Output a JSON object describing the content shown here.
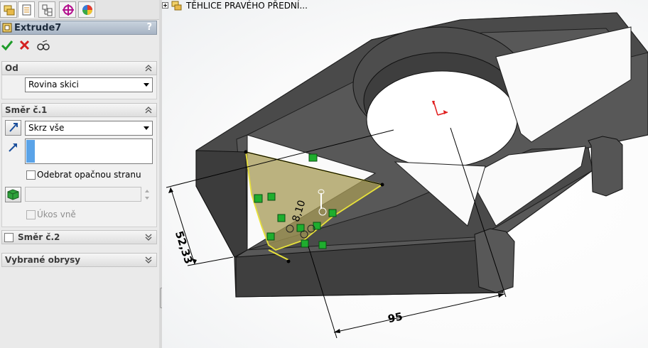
{
  "feature": {
    "title": "Extrude7",
    "help": "?",
    "actions": [
      "ok-icon",
      "cancel-icon",
      "preview-icon"
    ]
  },
  "tabs": [
    "feature-manager-icon",
    "property-manager-icon",
    "configuration-manager-icon",
    "dimxpert-icon",
    "display-manager-icon"
  ],
  "section_from": {
    "label": "Od",
    "start_condition": "Rovina skici"
  },
  "section_direction1": {
    "label": "Směr č.1",
    "end_condition": "Skrz vše",
    "flip_checkbox_label": "Odebrat opačnou stranu",
    "draft_label": "Úkos vně"
  },
  "section_direction2": {
    "label": "Směr č.2"
  },
  "section_contours": {
    "label": "Vybrané obrysy"
  },
  "tree": {
    "node_label": "TĚHLICE PRAVÉHO PŘEDNÍ..."
  },
  "dimensions": {
    "length": "95",
    "height": "52,33",
    "angle": "8,10"
  },
  "colors": {
    "model_gray": "#4a4a4a",
    "sketch_yellow": "#e8e23a",
    "relation_green": "#1fae2e",
    "origin_red": "#e01e1e"
  }
}
